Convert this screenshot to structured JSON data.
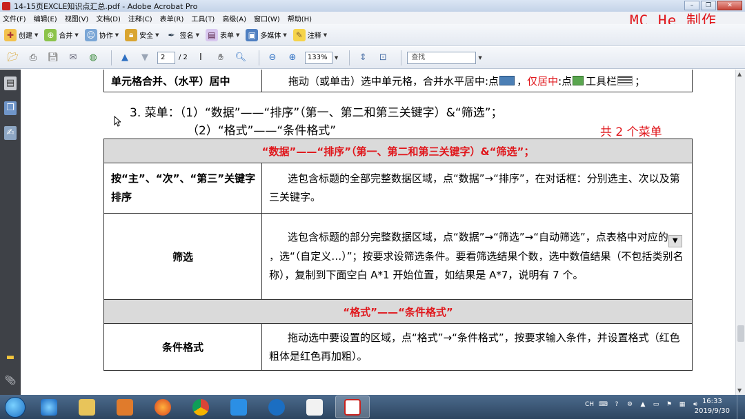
{
  "window": {
    "title": "14-15页EXCLE知识点汇总.pdf - Adobe Acrobat Pro",
    "minimize": "–",
    "restore": "❐",
    "close": "✕"
  },
  "watermark": "MC He 制作",
  "menu": [
    "文件(F)",
    "编辑(E)",
    "视图(V)",
    "文档(D)",
    "注释(C)",
    "表单(R)",
    "工具(T)",
    "高级(A)",
    "窗口(W)",
    "帮助(H)"
  ],
  "toolbar1": {
    "create": "创建",
    "combine": "合并",
    "collaborate": "协作",
    "secure": "安全",
    "sign": "签名",
    "forms": "表单",
    "multimedia": "多媒体",
    "comment": "注释"
  },
  "toolbar2": {
    "page_current": "2",
    "page_total": "/ 2",
    "zoom": "133%",
    "search_placeholder": "查找"
  },
  "document": {
    "top_row": {
      "label": "单元格合并、（水平）居中",
      "desc_a": "拖动（或单击）选中单元格，合并水平居中:点",
      "desc_b": "，",
      "desc_red": "仅居中",
      "desc_c": ":点",
      "desc_d": "工具栏",
      "desc_e": "；"
    },
    "heading_line1": "3. 菜单：（1）“数据”——“排序”（第一、第二和第三关键字）&“筛选”；",
    "heading_line2": "（2）“格式”——“条件格式”",
    "heading_note": "共 2 个菜单",
    "section1_title": "“数据”——“排序”（第一、第二和第三关键字）&“筛选”；",
    "row_sort": {
      "label": "按“主”、“次”、“第三”关键字排序",
      "desc": "选包含标题的全部完整数据区域，点“数据”→“排序”，在对话框：分别选主、次以及第三关键字。"
    },
    "row_filter": {
      "label": "筛选",
      "desc_a": "选包含标题的部分完整数据区域，点“数据”→“筛选”→“自动筛选”，点表格中对应的",
      "desc_b": "，选“（自定义…）”；按要求设筛选条件。要看筛选结果个数，选中数值结果（不包括类别名称），复制到下面空白 A*1 开始位置，如结果是 A*7，说明有 7 个。"
    },
    "section2_title": "“格式”——“条件格式”",
    "row_cond": {
      "label": "条件格式",
      "desc": "拖动选中要设置的区域，点“格式”→“条件格式”，按要求输入条件，并设置格式（红色粗体是红色再加粗）。"
    }
  },
  "tray": {
    "lang": "CH",
    "time": "16:33",
    "date": "2019/9/30"
  },
  "colors": {
    "accent_red": "#e0161b",
    "section_bg": "#dadada",
    "taskbar": "#2d4560"
  }
}
